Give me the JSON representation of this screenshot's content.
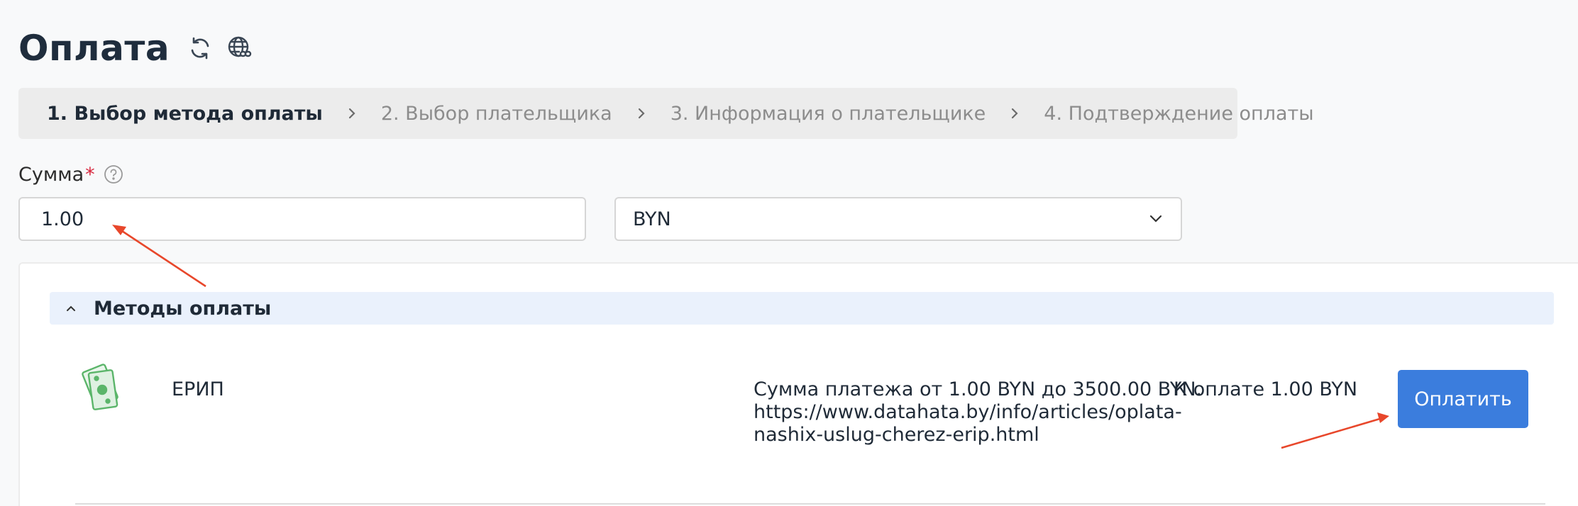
{
  "page": {
    "title": "Оплата"
  },
  "icons": {
    "refresh": "refresh-icon",
    "globe": "globe-link-icon",
    "help": "question-circle-icon",
    "chevron_right": "chevron-right-icon",
    "chevron_down": "chevron-down-icon",
    "chevron_up": "chevron-up-icon",
    "money": "money-bills-icon"
  },
  "steps": [
    {
      "label": "1. Выбор метода оплаты",
      "active": true
    },
    {
      "label": "2. Выбор плательщика",
      "active": false
    },
    {
      "label": "3. Информация о плательщике",
      "active": false
    },
    {
      "label": "4. Подтверждение оплаты",
      "active": false
    }
  ],
  "amount": {
    "label": "Сумма",
    "required_mark": "*",
    "value": "1.00"
  },
  "currency": {
    "selected": "BYN"
  },
  "methods": {
    "title": "Методы оплаты",
    "items": [
      {
        "name": "ЕРИП",
        "desc_line1": "Сумма платежа от 1.00 BYN до 3500.00 BYN.",
        "desc_line2": "https://www.datahata.by/info/articles/oplata-",
        "desc_line3": "nashix-uslug-cherez-erip.html",
        "total": "К оплате 1.00 BYN",
        "button_label": "Оплатить"
      }
    ]
  },
  "colors": {
    "accent": "#3b7ddd",
    "required": "#d7263d",
    "annotation": "#e8472b",
    "header_bg": "#eaf1fc",
    "money_icon": "#5bb56a"
  }
}
